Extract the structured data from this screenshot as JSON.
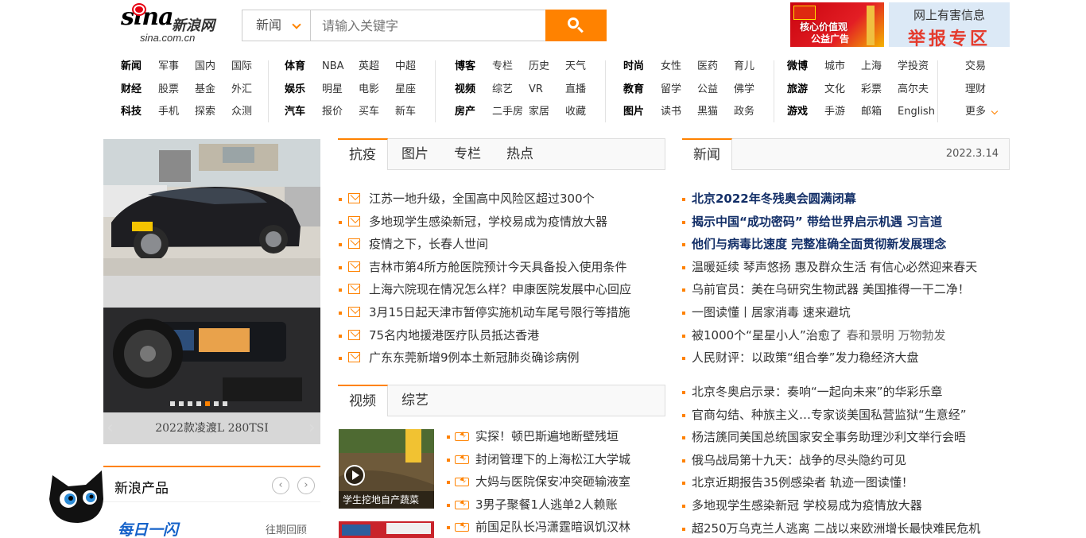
{
  "header": {
    "logo_mark": "sina",
    "logo_cn": "新浪网",
    "logo_en": "sina.com.cn",
    "search": {
      "category": "新闻",
      "placeholder": "请输入关键字",
      "button_icon": "search-icon"
    },
    "ad_core_values": {
      "line1": "核心价值观",
      "line2": "公益广告"
    },
    "ad_report": {
      "line1": "网上有害信息",
      "line2": "举报专区"
    }
  },
  "nav": {
    "groups": [
      {
        "rows": [
          [
            "新闻",
            "军事",
            "国内",
            "国际"
          ],
          [
            "财经",
            "股票",
            "基金",
            "外汇"
          ],
          [
            "科技",
            "手机",
            "探索",
            "众测"
          ]
        ]
      },
      {
        "rows": [
          [
            "体育",
            "NBA",
            "英超",
            "中超"
          ],
          [
            "娱乐",
            "明星",
            "电影",
            "星座"
          ],
          [
            "汽车",
            "报价",
            "买车",
            "新车"
          ]
        ]
      },
      {
        "rows": [
          [
            "博客",
            "专栏",
            "历史",
            "天气"
          ],
          [
            "视频",
            "综艺",
            "VR",
            "直播"
          ],
          [
            "房产",
            "二手房",
            "家居",
            "收藏"
          ]
        ]
      },
      {
        "rows": [
          [
            "时尚",
            "女性",
            "医药",
            "育儿"
          ],
          [
            "教育",
            "留学",
            "公益",
            "佛学"
          ],
          [
            "图片",
            "读书",
            "黑猫",
            "政务"
          ]
        ]
      },
      {
        "rows": [
          [
            "微博",
            "城市",
            "上海",
            "学投资"
          ],
          [
            "旅游",
            "文化",
            "彩票",
            "高尔夫"
          ],
          [
            "游戏",
            "手游",
            "邮箱",
            "English"
          ]
        ]
      },
      {
        "rows": [
          [
            "交易"
          ],
          [
            "理财"
          ],
          [
            "更多"
          ]
        ]
      }
    ]
  },
  "slider": {
    "caption": "2022款凌渡L 280TSI",
    "prev": "‹",
    "next": "›",
    "dots": 7,
    "active_dot": 4
  },
  "epidemic": {
    "tabs": [
      "抗疫",
      "图片",
      "专栏",
      "热点"
    ],
    "active_tab": 0,
    "items": [
      "江苏一地升级，全国高中风险区超过300个",
      "多地现学生感染新冠，学校易成为疫情放大器",
      "疫情之下，长春人世间",
      "吉林市第4所方舱医院预计今天具备投入使用条件",
      "上海六院现在情况怎么样？申康医院发展中心回应",
      "3月15日起天津市暂停实施机动车尾号限行等措施",
      "75名内地援港医疗队员抵达香港",
      "广东东莞新增9例本土新冠肺炎确诊病例"
    ]
  },
  "video": {
    "tabs": [
      "视频",
      "综艺"
    ],
    "active_tab": 0,
    "thumb_caption": "学生挖地自产蔬菜",
    "items": [
      "实探！顿巴斯遍地断壁残垣",
      "封闭管理下的上海松江大学城",
      "大妈与医院保安冲突砸输液室",
      "3男子聚餐1人逃单2人赖账",
      "前国足队长冯潇霆暗讽饥汉林"
    ]
  },
  "news": {
    "tab": "新闻",
    "date": "2022.3.14",
    "items_top": [
      {
        "text": "北京2022年冬残奥会圆满闭幕",
        "bold": true
      },
      {
        "text": "揭示中国“成功密码” 带给世界启示机遇 习言道",
        "bold": true
      },
      {
        "text": "他们与病毒比速度 完整准确全面贯彻新发展理念",
        "bold": true
      },
      {
        "text": "温暖延续 琴声悠扬 惠及群众生活 有信心必然迎来春天",
        "bold": false
      },
      {
        "text": "乌前官员：美在乌研究生物武器 美国推得一干二净！",
        "bold": false
      },
      {
        "text": "一图读懂丨居家消毒 速来避坑",
        "bold": false
      },
      {
        "text": "被1000个“星星小人”治愈了",
        "soft": "春和景明 万物勃发",
        "bold": false
      },
      {
        "text": "人民财评：以政策“组合拳”发力稳经济大盘",
        "bold": false
      }
    ],
    "items_bottom": [
      "北京冬奥启示录：奏响“一起向未来”的华彩乐章",
      "官商勾结、种族主义…专家谈美国私营监狱“生意经”",
      "杨洁篪同美国总统国家安全事务助理沙利文举行会晤",
      "俄乌战局第十九天：战争的尽头隐约可见",
      "北京近期报告35例感染者 轨迹一图读懂！",
      "多地现学生感染新冠 学校易成为疫情放大器",
      "超250万乌克兰人逃离 二战以来欧洲增长最快难民危机"
    ]
  },
  "products": {
    "title": "新浪产品",
    "prev": "‹",
    "next": "›",
    "daily": "每日一闪",
    "past": "往期回顾"
  },
  "colors": {
    "accent": "#ff8200",
    "headline": "#122e67",
    "report_red": "#e53a2c"
  }
}
